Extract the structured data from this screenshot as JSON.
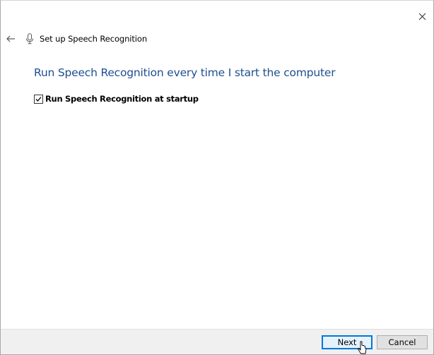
{
  "window": {
    "close_icon": "close-icon",
    "back_icon": "back-arrow-icon"
  },
  "header": {
    "title": "Set up Speech Recognition",
    "icon": "microphone-icon"
  },
  "main": {
    "heading": "Run Speech Recognition every time I start the computer",
    "startup_checkbox": {
      "label": "Run Speech Recognition at startup",
      "checked": true
    }
  },
  "footer": {
    "next_label": "Next",
    "cancel_label": "Cancel"
  },
  "colors": {
    "heading": "#1e4f8f",
    "focus_border": "#0078d7"
  }
}
